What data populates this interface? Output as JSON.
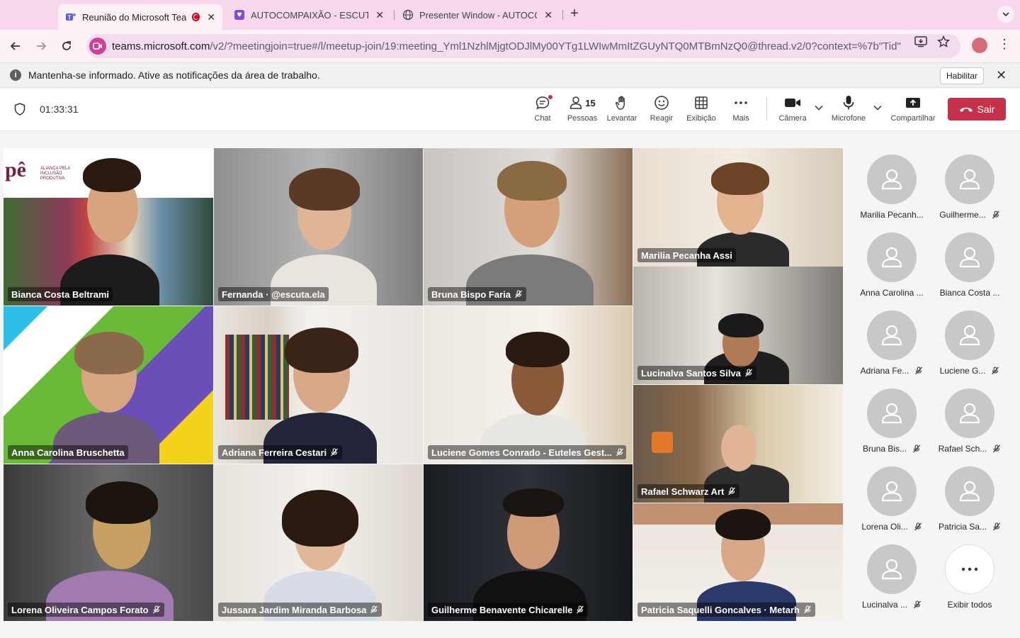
{
  "browser": {
    "tabs": [
      {
        "title": "Reunião do Microsoft Tea",
        "active": true,
        "icon": "teams-icon",
        "recording": true
      },
      {
        "title": "AUTOCOMPAIXÃO - ESCUTA",
        "active": false,
        "icon": "app-icon"
      },
      {
        "title": "Presenter Window - AUTOCO",
        "active": false,
        "icon": "globe-icon"
      }
    ],
    "url_domain": "teams.microsoft.com",
    "url_rest": "/v2/?meetingjoin=true#/l/meetup-join/19:meeting_Yml1NzhlMjgtODJlMy00YTg1LWIwMmItZGUyNTQ0MTBmNzQ0@thread.v2/0?context=%7b\"Tid\"...",
    "accent": "#f7d7ec"
  },
  "notification": {
    "text": "Mantenha-se informado. Ative as notificações da área de trabalho.",
    "button": "Habilitar"
  },
  "meeting": {
    "timer": "01:33:31",
    "people_count": "15",
    "toolbar": {
      "chat": "Chat",
      "people": "Pessoas",
      "raise": "Levantar",
      "react": "Reagir",
      "view": "Exibição",
      "more": "Mais",
      "camera": "Câmera",
      "mic": "Microfone",
      "share": "Compartilhar",
      "leave": "Sair"
    },
    "leave_color": "#c4314b"
  },
  "tiles": [
    {
      "name": "Bianca Costa Beltrami",
      "muted": false
    },
    {
      "name": "Fernanda · @escuta.ela",
      "muted": false
    },
    {
      "name": "Bruna Bispo Faria",
      "muted": true
    },
    {
      "name": "Marilia Pecanha Assi",
      "muted": false
    },
    {
      "name": "Lucinalva Santos Silva",
      "muted": true
    },
    {
      "name": "Anna Carolina Bruschetta",
      "muted": false
    },
    {
      "name": "Adriana Ferreira Cestari",
      "muted": true
    },
    {
      "name": "Luciene Gomes Conrado - Euteles Gest...",
      "muted": true
    },
    {
      "name": "Rafael Schwarz Art",
      "muted": true
    },
    {
      "name": "Lorena Oliveira Campos Forato",
      "muted": true
    },
    {
      "name": "Jussara Jardim Miranda Barbosa",
      "muted": true
    },
    {
      "name": "Guilherme Benavente Chicarelle",
      "muted": true
    },
    {
      "name": "Patricia Saquelli Goncalves · Metarh",
      "muted": true
    }
  ],
  "background_logo": {
    "text": "pê",
    "subtitle": "ALIANÇA PELA INCLUSÃO PRODUTIVA"
  },
  "roster": [
    {
      "name": "Marilia Pecanh...",
      "muted": false
    },
    {
      "name": "Guilherme...",
      "muted": true
    },
    {
      "name": "Anna Carolina ...",
      "muted": false
    },
    {
      "name": "Bianca Costa ...",
      "muted": false
    },
    {
      "name": "Adriana Fe...",
      "muted": true
    },
    {
      "name": "Luciene G...",
      "muted": true
    },
    {
      "name": "Bruna Bis...",
      "muted": true
    },
    {
      "name": "Rafael Sch...",
      "muted": true
    },
    {
      "name": "Lorena Oli...",
      "muted": true
    },
    {
      "name": "Patricia Sa...",
      "muted": true
    },
    {
      "name": "Lucinalva ...",
      "muted": true
    }
  ],
  "roster_more": "Exibir todos"
}
